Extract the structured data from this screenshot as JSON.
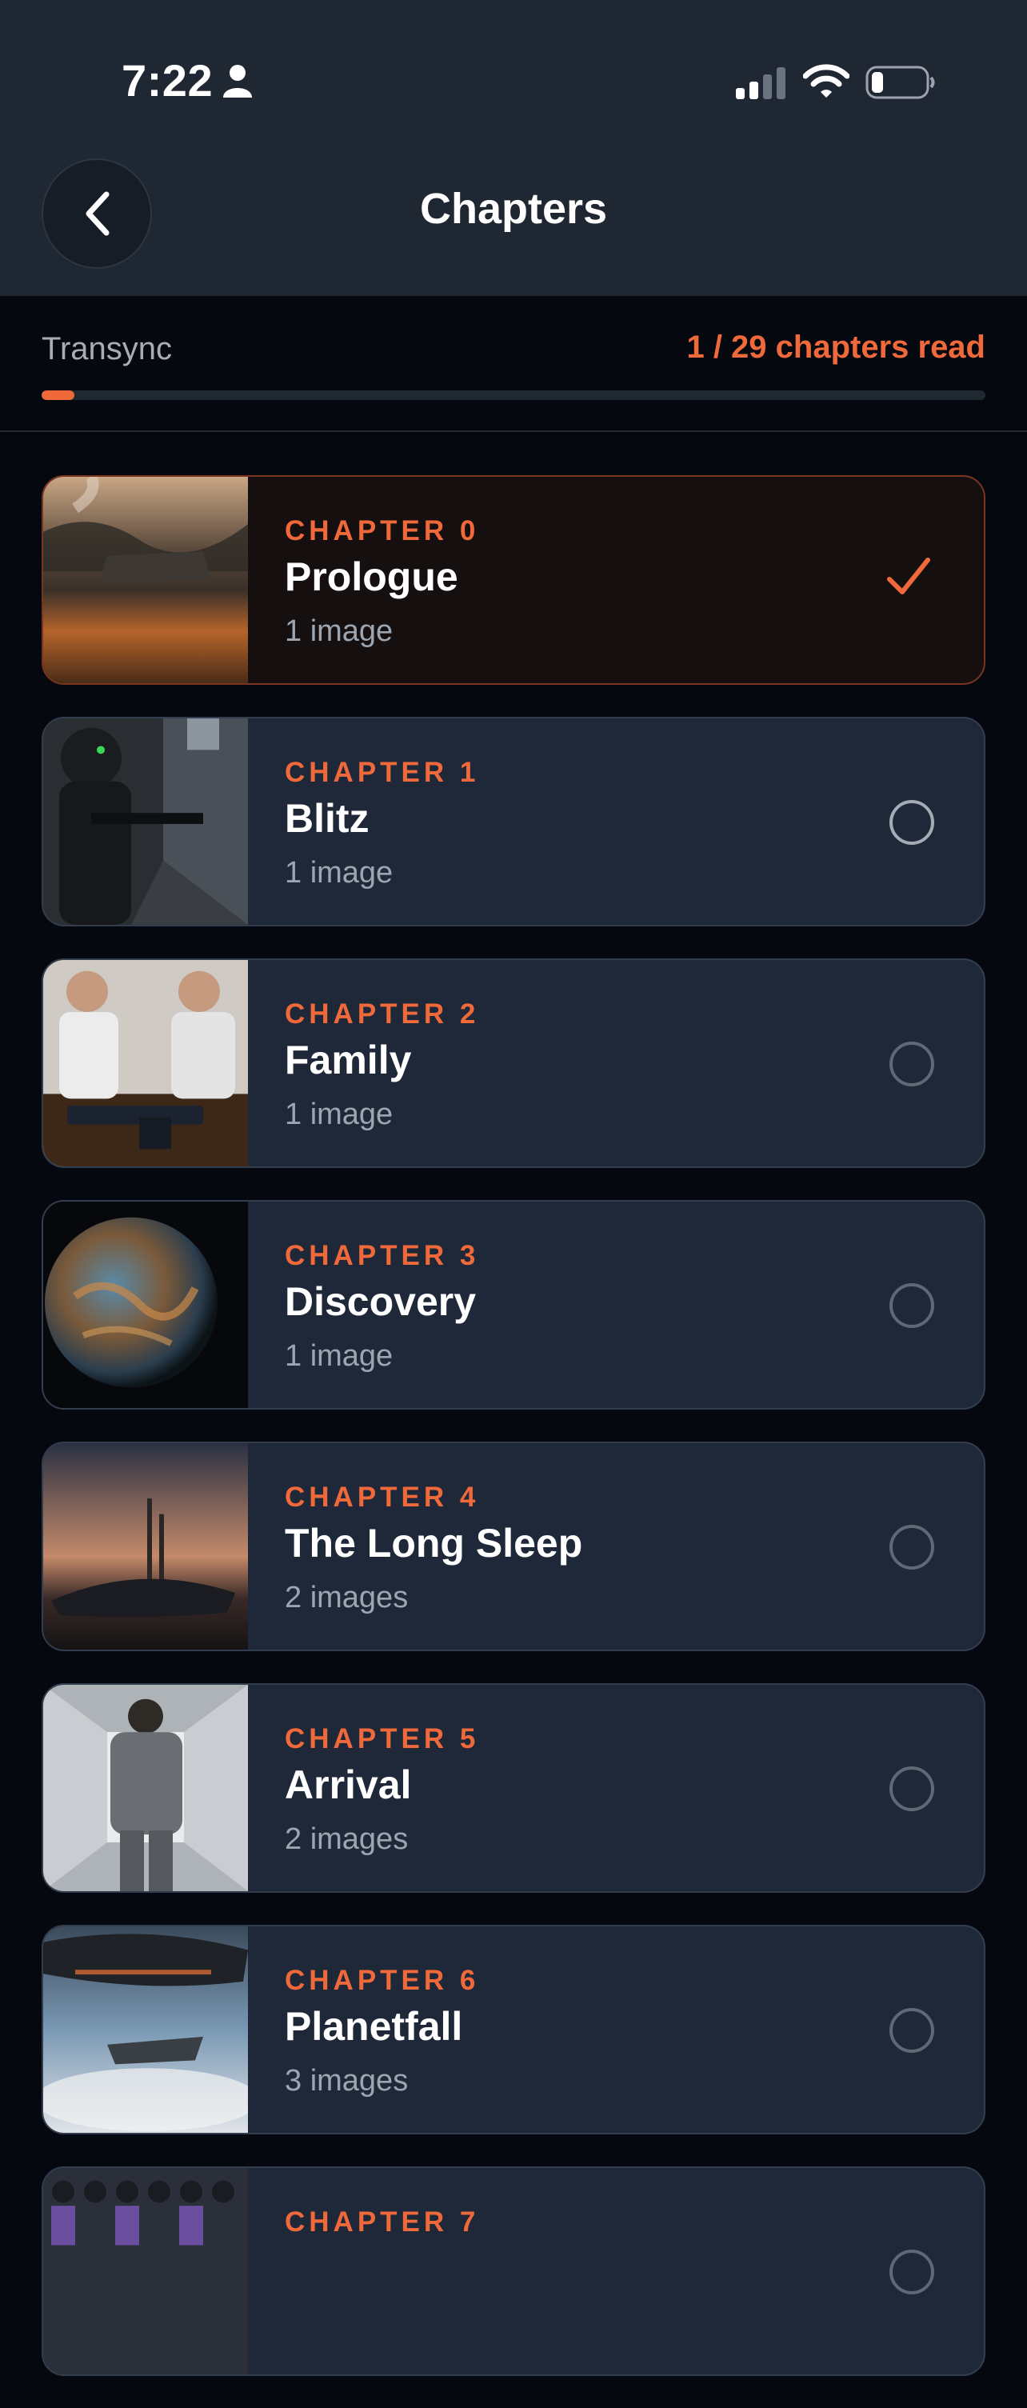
{
  "status_bar": {
    "time": "7:22"
  },
  "header": {
    "title": "Chapters"
  },
  "progress": {
    "book": "Transync",
    "label": "1 / 29 chapters read",
    "read": 1,
    "total": 29
  },
  "colors": {
    "accent": "#f0693a",
    "card": "#1f2838",
    "background": "#05080f"
  },
  "chapters": [
    {
      "number": "CHAPTER 0",
      "title": "Prologue",
      "images": "1 image",
      "status": "read"
    },
    {
      "number": "CHAPTER 1",
      "title": "Blitz",
      "images": "1 image",
      "status": "unread"
    },
    {
      "number": "CHAPTER 2",
      "title": "Family",
      "images": "1 image",
      "status": "unread"
    },
    {
      "number": "CHAPTER 3",
      "title": "Discovery",
      "images": "1 image",
      "status": "unread"
    },
    {
      "number": "CHAPTER 4",
      "title": "The Long Sleep",
      "images": "2 images",
      "status": "unread"
    },
    {
      "number": "CHAPTER 5",
      "title": "Arrival",
      "images": "2 images",
      "status": "unread"
    },
    {
      "number": "CHAPTER 6",
      "title": "Planetfall",
      "images": "3 images",
      "status": "unread"
    },
    {
      "number": "CHAPTER 7",
      "title": "",
      "images": "",
      "status": "unread"
    }
  ]
}
